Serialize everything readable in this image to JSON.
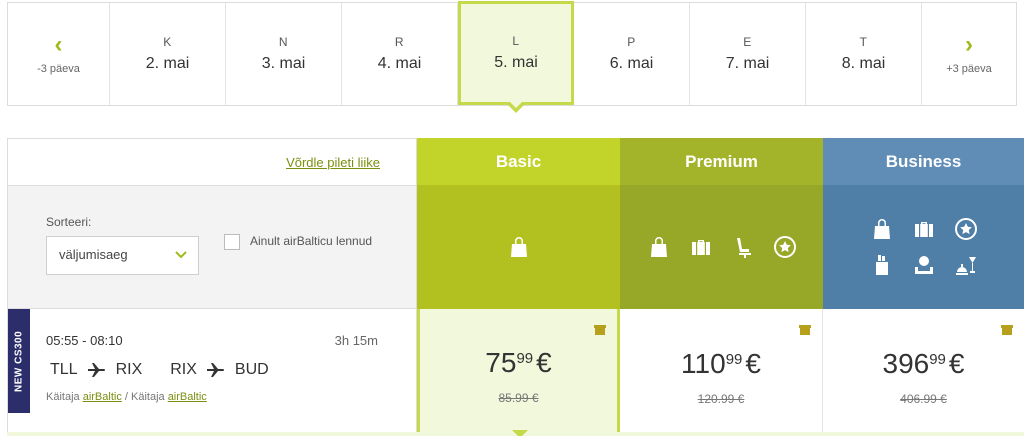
{
  "date_strip": {
    "prev": {
      "arrow": "‹",
      "label": "-3 päeva"
    },
    "next": {
      "arrow": "›",
      "label": "+3 päeva"
    },
    "days": [
      {
        "dow": "K",
        "date": "2. mai"
      },
      {
        "dow": "N",
        "date": "3. mai"
      },
      {
        "dow": "R",
        "date": "4. mai"
      },
      {
        "dow": "L",
        "date": "5. mai",
        "selected": true
      },
      {
        "dow": "P",
        "date": "6. mai"
      },
      {
        "dow": "E",
        "date": "7. mai"
      },
      {
        "dow": "T",
        "date": "8. mai"
      }
    ]
  },
  "table": {
    "compare_link": "Võrdle pileti liike",
    "sort_label": "Sorteeri:",
    "sort_value": "väljumisaeg",
    "checkbox_label": "Ainult airBalticu lennud",
    "fares": [
      {
        "name": "Basic",
        "color_head": "#c2d32a",
        "color_body": "#b2c11f",
        "icons": [
          "bag-icon"
        ]
      },
      {
        "name": "Premium",
        "color_head": "#a3b32a",
        "color_body": "#97a829",
        "icons": [
          "bag-icon",
          "suitcase-icon",
          "seat-icon",
          "star-icon"
        ]
      },
      {
        "name": "Business",
        "color_head": "#5f8db6",
        "color_body": "#4f7ea7",
        "icons": [
          "bag-icon",
          "suitcase-icon",
          "star-icon",
          "golf-icon",
          "lounge-icon",
          "dining-icon"
        ]
      }
    ]
  },
  "flight": {
    "aircraft_tag": "NEW CS300",
    "times": "05:55 - 08:10",
    "duration": "3h 15m",
    "route": [
      {
        "from": "TLL",
        "to": "RIX"
      },
      {
        "from": "RIX",
        "to": "BUD"
      }
    ],
    "operated_prefix": "Käitaja ",
    "operated_separator": " / Käitaja ",
    "operator": "airBaltic",
    "prices": [
      {
        "fare": "Basic",
        "main": "75",
        "cents": "99",
        "currency": "€",
        "old": "85.99 €"
      },
      {
        "fare": "Premium",
        "main": "110",
        "cents": "99",
        "currency": "€",
        "old": "120.99 €"
      },
      {
        "fare": "Business",
        "main": "396",
        "cents": "99",
        "currency": "€",
        "old": "406.99 €"
      }
    ]
  }
}
